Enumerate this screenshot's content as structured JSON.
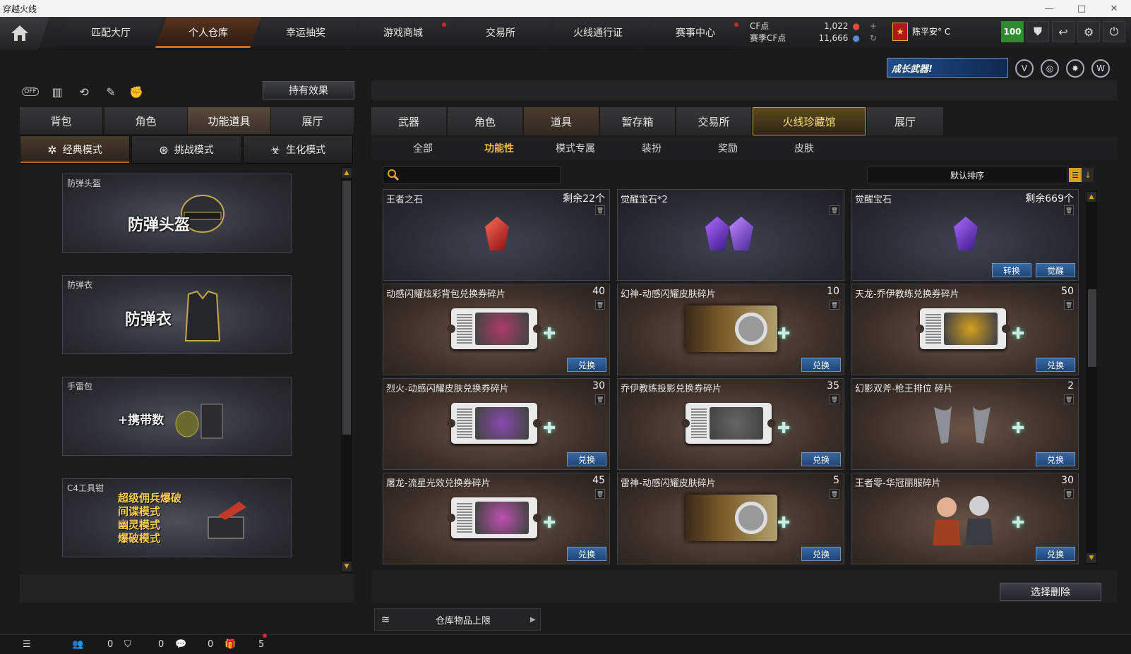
{
  "window": {
    "title": "穿越火线",
    "minimize": "—",
    "maximize": "□",
    "close": "✕"
  },
  "nav": {
    "home_icon": "home-icon",
    "tabs": [
      {
        "label": "匹配大厅",
        "active": false,
        "dot": false
      },
      {
        "label": "个人仓库",
        "active": true,
        "dot": false
      },
      {
        "label": "幸运抽奖",
        "active": false,
        "dot": false
      },
      {
        "label": "游戏商城",
        "active": false,
        "dot": true
      },
      {
        "label": "交易所",
        "active": false,
        "dot": false
      },
      {
        "label": "火线通行证",
        "active": false,
        "dot": false
      },
      {
        "label": "赛事中心",
        "active": false,
        "dot": true
      }
    ]
  },
  "currency": {
    "cf_label": "CF点",
    "cf_value": "1,022",
    "event_label": "赛季CF点",
    "event_value": "11,666",
    "add_symbol": "+",
    "refresh_symbol": "↻"
  },
  "user": {
    "rank_symbol": "★",
    "name": "陈平安° C",
    "level": "100"
  },
  "top_icons": [
    "shield-icon",
    "return-icon",
    "gear-icon",
    "power-icon"
  ],
  "top_glyphs": [
    "⛊",
    "↩",
    "⚙",
    "⏻"
  ],
  "banner": {
    "text": "成长武器!"
  },
  "banner_icons": [
    "V",
    "◎",
    "✸",
    "W"
  ],
  "left": {
    "toggle_off": "OFF",
    "hold_effect": "持有效果",
    "tabs": [
      {
        "label": "背包",
        "active": false
      },
      {
        "label": "角色",
        "active": false
      },
      {
        "label": "功能道具",
        "active": true
      },
      {
        "label": "展厅",
        "active": false
      }
    ],
    "modes": [
      {
        "label": "经典模式",
        "icon": "✲",
        "active": true
      },
      {
        "label": "挑战模式",
        "icon": "⊛",
        "active": false
      },
      {
        "label": "生化模式",
        "icon": "☣",
        "active": false
      }
    ],
    "items": [
      {
        "title": "防弹头盔",
        "art": "防弹头盔"
      },
      {
        "title": "防弹衣",
        "art": "防弹衣"
      },
      {
        "title": "手雷包",
        "art": "+携带数"
      },
      {
        "title": "C4工具钳",
        "modes": [
          "超级佣兵爆破",
          "间谍模式",
          "幽灵模式",
          "爆破模式"
        ]
      }
    ]
  },
  "right": {
    "tabs": [
      {
        "label": "武器",
        "state": "normal"
      },
      {
        "label": "角色",
        "state": "normal"
      },
      {
        "label": "道具",
        "state": "active"
      },
      {
        "label": "暂存箱",
        "state": "normal"
      },
      {
        "label": "交易所",
        "state": "normal"
      },
      {
        "label": "火线珍藏馆",
        "state": "gold"
      },
      {
        "label": "展厅",
        "state": "normal"
      }
    ],
    "subtabs": [
      {
        "label": "全部",
        "active": false
      },
      {
        "label": "功能性",
        "active": true
      },
      {
        "label": "模式专属",
        "active": false
      },
      {
        "label": "装扮",
        "active": false
      },
      {
        "label": "奖励",
        "active": false
      },
      {
        "label": "皮肤",
        "active": false
      }
    ],
    "search_placeholder": "",
    "sort_label": "默认排序",
    "sort_list_glyph": "☰",
    "sort_dir_glyph": "↓",
    "items": [
      {
        "name": "王者之石",
        "count": "剩余22个",
        "kind": "stone",
        "gem": "red",
        "buttons": []
      },
      {
        "name": "觉醒宝石*2",
        "count": "",
        "kind": "stone",
        "gem": "purple2",
        "buttons": []
      },
      {
        "name": "觉醒宝石",
        "count": "剩余669个",
        "kind": "stone",
        "gem": "purple",
        "buttons": [
          "转换",
          "觉醒"
        ]
      },
      {
        "name": "动感闪耀炫彩背包兑换券碎片",
        "count": "40",
        "kind": "ticket",
        "pic": "#b03a6a",
        "buttons": [
          "兑换"
        ]
      },
      {
        "name": "幻神-动感闪耀皮肤碎片",
        "count": "10",
        "kind": "weapon",
        "pic": "#8a6a3a",
        "buttons": [
          "兑换"
        ]
      },
      {
        "name": "天龙-乔伊教练兑换券碎片",
        "count": "50",
        "kind": "ticket",
        "pic": "#d4a020",
        "buttons": [
          "兑换"
        ]
      },
      {
        "name": "烈火-动感闪耀皮肤兑换券碎片",
        "count": "30",
        "kind": "ticket",
        "pic": "#8a4ab0",
        "buttons": [
          "兑换"
        ]
      },
      {
        "name": "乔伊教练投影兑换券碎片",
        "count": "35",
        "kind": "ticket",
        "pic": "#666",
        "buttons": [
          "兑换"
        ]
      },
      {
        "name": "幻影双斧-枪王排位 碎片",
        "count": "2",
        "kind": "axes",
        "pic": "#777",
        "buttons": [
          "兑换"
        ]
      },
      {
        "name": "屠龙-流星光效兑换券碎片",
        "count": "45",
        "kind": "ticket",
        "pic": "#c050b0",
        "buttons": [
          "兑换"
        ]
      },
      {
        "name": "雷神-动感闪耀皮肤碎片",
        "count": "5",
        "kind": "weapon",
        "pic": "#8a6a3a",
        "buttons": [
          "兑换"
        ]
      },
      {
        "name": "王者零-华冠丽服碎片",
        "count": "30",
        "kind": "chars",
        "pic": "#a04020",
        "buttons": [
          "兑换"
        ]
      }
    ],
    "select_delete": "选择删除",
    "storage_limit": "仓库物品上限"
  },
  "bottom": {
    "counts": [
      "0",
      "0",
      "0",
      "5"
    ],
    "icons": [
      "menu-icon",
      "friends-icon",
      "shield-icon",
      "chat-icon",
      "gift-icon"
    ]
  },
  "colors": {
    "accent_gold": "#d9a020",
    "button_blue": "#2c5a92",
    "active_orange": "#c56a2a",
    "level_green": "#2e8b2e"
  }
}
